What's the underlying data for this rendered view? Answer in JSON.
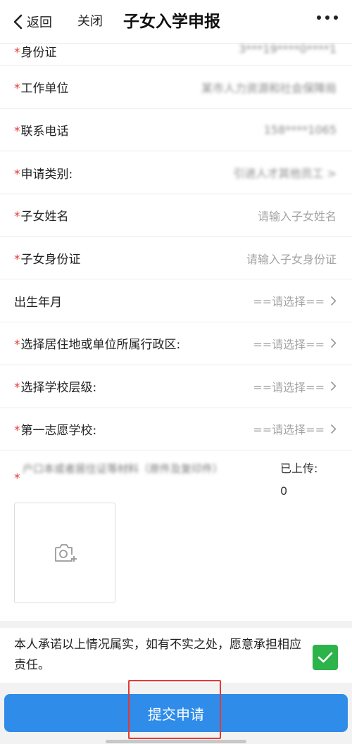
{
  "nav": {
    "back_label": "返回",
    "close_label": "关闭",
    "title": "子女入学申报"
  },
  "form": {
    "required_mark": "*",
    "rows": [
      {
        "label": "身份证",
        "required": true,
        "value": "3***19****0****1"
      },
      {
        "label": "工作单位",
        "required": true,
        "value": "某市人力资源和社会保障局"
      },
      {
        "label": "联系电话",
        "required": true,
        "value": "158****1065"
      },
      {
        "label": "申请类别:",
        "required": true,
        "value": "引进人才其他员工 >"
      },
      {
        "label": "子女姓名",
        "required": true,
        "placeholder": "请输入子女姓名"
      },
      {
        "label": "子女身份证",
        "required": true,
        "placeholder": "请输入子女身份证"
      },
      {
        "label": "出生年月",
        "required": false,
        "placeholder": "==请选择=="
      },
      {
        "label": "选择居住地或单位所属行政区:",
        "required": true,
        "placeholder": "==请选择=="
      },
      {
        "label": "选择学校层级:",
        "required": true,
        "placeholder": "==请选择=="
      },
      {
        "label": "第一志愿学校:",
        "required": true,
        "placeholder": "==请选择=="
      }
    ]
  },
  "upload": {
    "description": "户口本或者居住证等材料（原件及复印件）",
    "uploaded_label": "已上传:",
    "uploaded_count": "0"
  },
  "pledge": {
    "text": "本人承诺以上情况属实，如有不实之处，愿意承担相应责任。",
    "checked": true
  },
  "submit": {
    "label": "提交申请"
  },
  "colors": {
    "required": "#e03c2f",
    "primary": "#2f8ce9",
    "checkbox": "#2cb34a",
    "highlight": "#e53935"
  }
}
